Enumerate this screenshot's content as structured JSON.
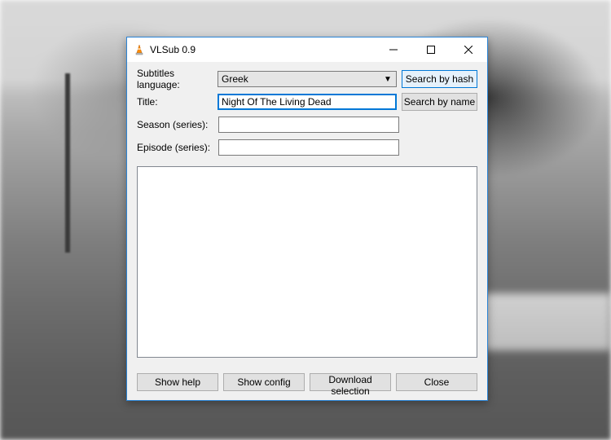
{
  "window": {
    "title": "VLSub 0.9"
  },
  "form": {
    "language_label": "Subtitles language:",
    "language_value": "Greek",
    "title_label": "Title:",
    "title_value": "Night Of The Living Dead",
    "season_label": "Season (series):",
    "season_value": "",
    "episode_label": "Episode (series):",
    "episode_value": ""
  },
  "buttons": {
    "search_hash": "Search by hash",
    "search_name": "Search by name",
    "show_help": "Show help",
    "show_config": "Show config",
    "download_selection": "Download selection",
    "close": "Close"
  }
}
